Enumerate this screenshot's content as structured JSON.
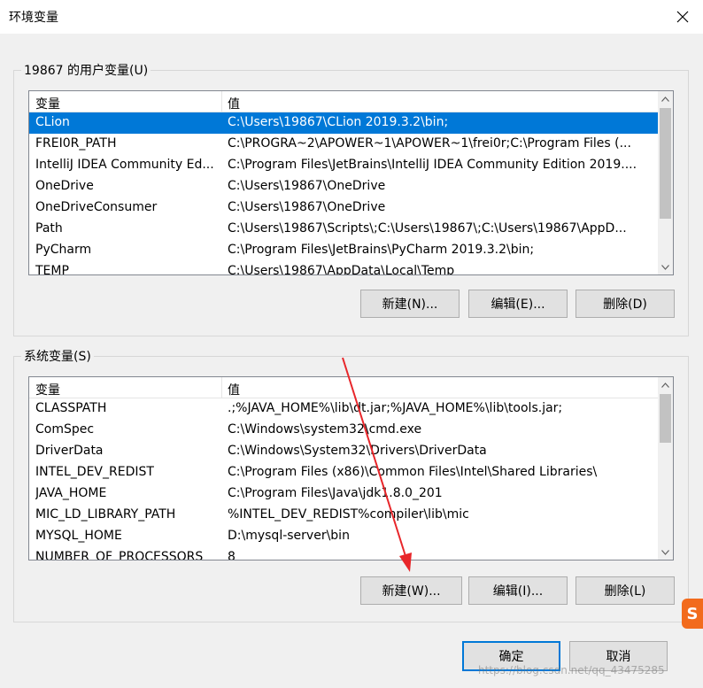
{
  "window": {
    "title": "环境变量"
  },
  "user_group": {
    "legend": "19867 的用户变量(U)",
    "col_variable": "变量",
    "col_value": "值",
    "rows": [
      {
        "name": "CLion",
        "value": "C:\\Users\\19867\\CLion 2019.3.2\\bin;",
        "selected": true
      },
      {
        "name": "FREI0R_PATH",
        "value": "C:\\PROGRA~2\\APOWER~1\\APOWER~1\\frei0r;C:\\Program Files (..."
      },
      {
        "name": "IntelliJ IDEA Community Ed...",
        "value": "C:\\Program Files\\JetBrains\\IntelliJ IDEA Community Edition 2019...."
      },
      {
        "name": "OneDrive",
        "value": "C:\\Users\\19867\\OneDrive"
      },
      {
        "name": "OneDriveConsumer",
        "value": "C:\\Users\\19867\\OneDrive"
      },
      {
        "name": "Path",
        "value": "C:\\Users\\19867\\Scripts\\;C:\\Users\\19867\\;C:\\Users\\19867\\AppD..."
      },
      {
        "name": "PyCharm",
        "value": "C:\\Program Files\\JetBrains\\PyCharm 2019.3.2\\bin;"
      },
      {
        "name": "TEMP",
        "value": "C:\\Users\\19867\\AppData\\Local\\Temp"
      }
    ],
    "new_label": "新建(N)...",
    "edit_label": "编辑(E)...",
    "delete_label": "删除(D)"
  },
  "system_group": {
    "legend": "系统变量(S)",
    "col_variable": "变量",
    "col_value": "值",
    "rows": [
      {
        "name": "CLASSPATH",
        "value": ".;%JAVA_HOME%\\lib\\dt.jar;%JAVA_HOME%\\lib\\tools.jar;"
      },
      {
        "name": "ComSpec",
        "value": "C:\\Windows\\system32\\cmd.exe"
      },
      {
        "name": "DriverData",
        "value": "C:\\Windows\\System32\\Drivers\\DriverData"
      },
      {
        "name": "INTEL_DEV_REDIST",
        "value": "C:\\Program Files (x86)\\Common Files\\Intel\\Shared Libraries\\"
      },
      {
        "name": "JAVA_HOME",
        "value": "C:\\Program Files\\Java\\jdk1.8.0_201"
      },
      {
        "name": "MIC_LD_LIBRARY_PATH",
        "value": "%INTEL_DEV_REDIST%compiler\\lib\\mic"
      },
      {
        "name": "MYSQL_HOME",
        "value": "D:\\mysql-server\\bin"
      },
      {
        "name": "NUMBER_OF_PROCESSORS",
        "value": "8"
      }
    ],
    "new_label": "新建(W)...",
    "edit_label": "编辑(I)...",
    "delete_label": "删除(L)"
  },
  "footer": {
    "ok_label": "确定",
    "cancel_label": "取消"
  },
  "watermark": "https://blog.csdn.net/qq_43475285",
  "logo_letter": "S",
  "colors": {
    "selection": "#0078d7",
    "annotation_arrow": "#e8262a",
    "logo": "#f26b1d"
  }
}
